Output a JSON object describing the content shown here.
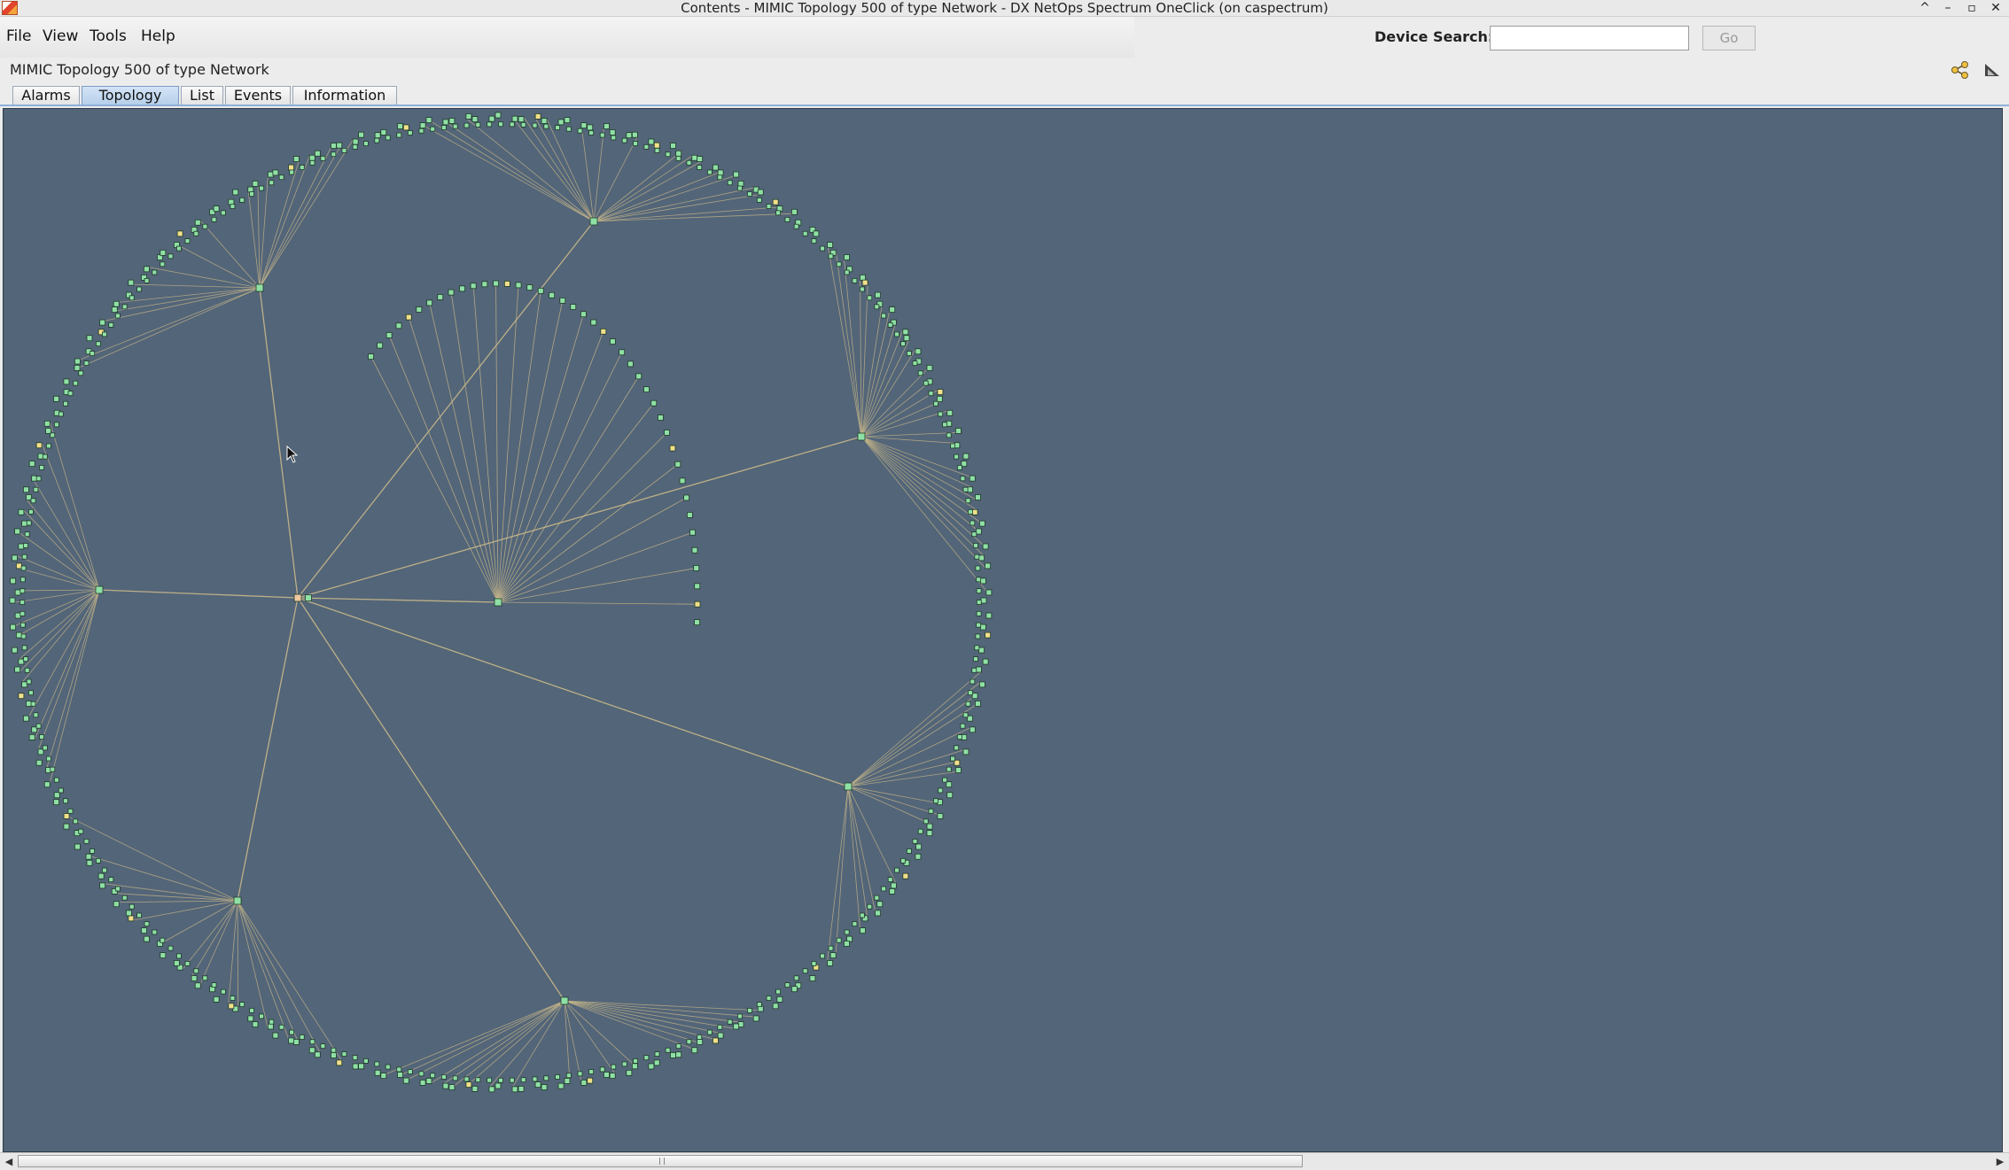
{
  "window": {
    "title": "Contents - MIMIC Topology 500 of type Network - DX NetOps Spectrum OneClick (on caspectrum)",
    "controls": [
      "^",
      "–",
      "▫",
      "✕"
    ]
  },
  "menu": {
    "file": "File",
    "view": "View",
    "tools": "Tools",
    "help": "Help"
  },
  "search": {
    "label": "Device Search:",
    "value": "",
    "placeholder": "",
    "go_label": "Go"
  },
  "panel": {
    "title": "MIMIC Topology 500 of type Network",
    "icons": [
      "topology-share-icon",
      "export-icon"
    ]
  },
  "tabs": [
    {
      "label": "Alarms",
      "active": false
    },
    {
      "label": "Topology",
      "active": true
    },
    {
      "label": "List",
      "active": false
    },
    {
      "label": "Events",
      "active": false
    },
    {
      "label": "Information",
      "active": false
    }
  ],
  "topology": {
    "background": "#536578",
    "link_color": "#c9b88a",
    "device_color": "#8fe0a5",
    "minor_alarm_color": "#f2e08a",
    "hub_count": 9,
    "outer_ring_nodes": 264,
    "inner_arc_nodes": 42
  },
  "scrollbar": {
    "left_arrow": "◀",
    "right_arrow": "▶"
  }
}
